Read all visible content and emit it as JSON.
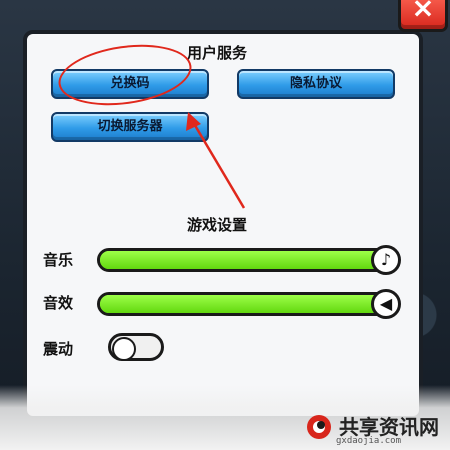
{
  "close_button": {
    "label": "×",
    "icon": "close-icon"
  },
  "user_service": {
    "title": "用户服务",
    "buttons": [
      {
        "label": "兑换码"
      },
      {
        "label": "隐私协议"
      },
      {
        "label": "切换服务器"
      }
    ]
  },
  "game_settings": {
    "title": "游戏设置",
    "music": {
      "label": "音乐",
      "icon": "music-note-icon",
      "icon_glyph": "♪",
      "level": 1.0
    },
    "sound": {
      "label": "音效",
      "icon": "speaker-icon",
      "icon_glyph": "◀",
      "level": 1.0
    },
    "vibration": {
      "label": "震动",
      "state": "off"
    }
  },
  "watermark": {
    "text": "共享资讯网",
    "url": "gxdaojia.com"
  },
  "colors": {
    "slider_green": "#7ef21f",
    "button_blue": "#2f9be8",
    "annotation_red": "#e0281c",
    "close_red": "#d8261c"
  }
}
